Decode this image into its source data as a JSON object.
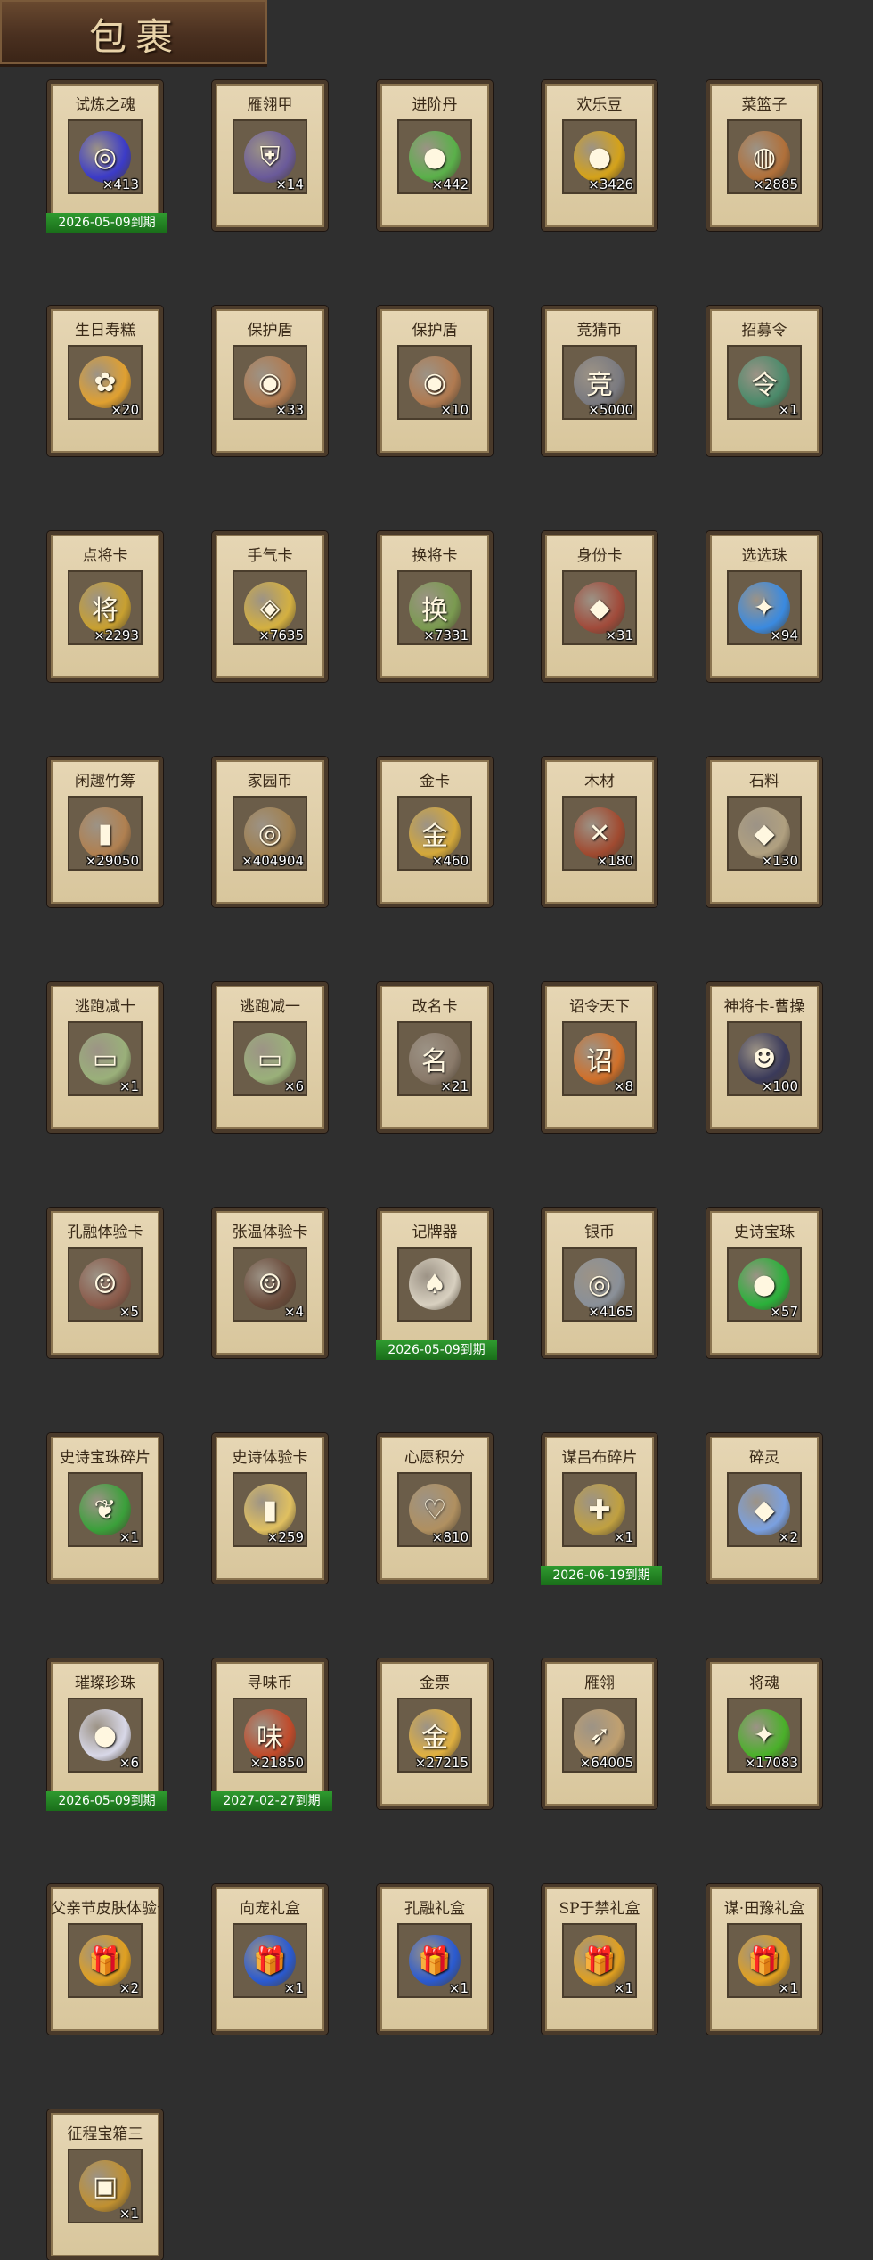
{
  "header": {
    "title": "包裹"
  },
  "items": [
    {
      "name": "试炼之魂",
      "count": "×413",
      "expiry": "2026-05-09到期",
      "icon": "blue-orb-icon",
      "color": "#3b3bc8",
      "glyph": "◎"
    },
    {
      "name": "雁翎甲",
      "count": "×14",
      "expiry": "",
      "icon": "armor-icon",
      "color": "#6a5a9a",
      "glyph": "⛨"
    },
    {
      "name": "进阶丹",
      "count": "×442",
      "expiry": "",
      "icon": "green-pill-icon",
      "color": "#5ab04a",
      "glyph": "●"
    },
    {
      "name": "欢乐豆",
      "count": "×3426",
      "expiry": "",
      "icon": "gold-beans-icon",
      "color": "#d4a21a",
      "glyph": "●"
    },
    {
      "name": "菜篮子",
      "count": "×2885",
      "expiry": "",
      "icon": "vegetable-basket-icon",
      "color": "#b0703a",
      "glyph": "◍"
    },
    {
      "name": "生日寿糕",
      "count": "×20",
      "expiry": "",
      "icon": "birthday-cake-icon",
      "color": "#e0a030",
      "glyph": "✿"
    },
    {
      "name": "保护盾",
      "count": "×33",
      "expiry": "",
      "icon": "shield-icon",
      "color": "#b07a50",
      "glyph": "◉"
    },
    {
      "name": "保护盾",
      "count": "×10",
      "expiry": "",
      "icon": "shield-icon",
      "color": "#b07a50",
      "glyph": "◉"
    },
    {
      "name": "竞猜币",
      "count": "×5000",
      "expiry": "",
      "icon": "guess-coin-icon",
      "color": "#7a7a80",
      "glyph": "竞"
    },
    {
      "name": "招募令",
      "count": "×1",
      "expiry": "",
      "icon": "recruit-token-icon",
      "color": "#4a8a6a",
      "glyph": "令"
    },
    {
      "name": "点将卡",
      "count": "×2293",
      "expiry": "",
      "icon": "general-card-icon",
      "color": "#c8a030",
      "glyph": "将"
    },
    {
      "name": "手气卡",
      "count": "×7635",
      "expiry": "",
      "icon": "luck-card-icon",
      "color": "#d4b040",
      "glyph": "◈"
    },
    {
      "name": "换将卡",
      "count": "×7331",
      "expiry": "",
      "icon": "swap-card-icon",
      "color": "#7a9a50",
      "glyph": "换"
    },
    {
      "name": "身份卡",
      "count": "×31",
      "expiry": "",
      "icon": "identity-card-icon",
      "color": "#a04a3a",
      "glyph": "◆"
    },
    {
      "name": "选选珠",
      "count": "×94",
      "expiry": "",
      "icon": "blue-flame-orb-icon",
      "color": "#3a8ae0",
      "glyph": "✦"
    },
    {
      "name": "闲趣竹筹",
      "count": "×29050",
      "expiry": "",
      "icon": "bamboo-token-icon",
      "color": "#b08050",
      "glyph": "▮"
    },
    {
      "name": "家园币",
      "count": "×404904",
      "expiry": "",
      "icon": "home-coin-icon",
      "color": "#a08050",
      "glyph": "◎"
    },
    {
      "name": "金卡",
      "count": "×460",
      "expiry": "",
      "icon": "gold-card-icon",
      "color": "#d4a83a",
      "glyph": "金"
    },
    {
      "name": "木材",
      "count": "×180",
      "expiry": "",
      "icon": "wood-icon",
      "color": "#a04a30",
      "glyph": "✕"
    },
    {
      "name": "石料",
      "count": "×130",
      "expiry": "",
      "icon": "stone-icon",
      "color": "#b0a080",
      "glyph": "◆"
    },
    {
      "name": "逃跑减十",
      "count": "×1",
      "expiry": "",
      "icon": "escape-tag-icon",
      "color": "#9ab07a",
      "glyph": "▭"
    },
    {
      "name": "逃跑减一",
      "count": "×6",
      "expiry": "",
      "icon": "escape-tag-icon",
      "color": "#9ab07a",
      "glyph": "▭"
    },
    {
      "name": "改名卡",
      "count": "×21",
      "expiry": "",
      "icon": "rename-card-icon",
      "color": "#8a7a6a",
      "glyph": "名"
    },
    {
      "name": "诏令天下",
      "count": "×8",
      "expiry": "",
      "icon": "edict-scroll-icon",
      "color": "#d0702a",
      "glyph": "诏"
    },
    {
      "name": "神将卡-曹操",
      "count": "×100",
      "expiry": "",
      "icon": "general-portrait-icon",
      "color": "#3a3a5a",
      "glyph": "☻"
    },
    {
      "name": "孔融体验卡",
      "count": "×5",
      "expiry": "",
      "icon": "general-portrait-icon",
      "color": "#8a5a4a",
      "glyph": "☺"
    },
    {
      "name": "张温体验卡",
      "count": "×4",
      "expiry": "",
      "icon": "general-portrait-icon",
      "color": "#6a4a3a",
      "glyph": "☺"
    },
    {
      "name": "记牌器",
      "count": "",
      "expiry": "2026-05-09到期",
      "icon": "playing-cards-icon",
      "color": "#d8d0c0",
      "glyph": "♠"
    },
    {
      "name": "银币",
      "count": "×4165",
      "expiry": "",
      "icon": "silver-coin-icon",
      "color": "#8a9098",
      "glyph": "◎"
    },
    {
      "name": "史诗宝珠",
      "count": "×57",
      "expiry": "",
      "icon": "green-orb-icon",
      "color": "#2ab03a",
      "glyph": "●"
    },
    {
      "name": "史诗宝珠碎片",
      "count": "×1",
      "expiry": "",
      "icon": "green-leaf-icon",
      "color": "#3aa03a",
      "glyph": "❦"
    },
    {
      "name": "史诗体验卡",
      "count": "×259",
      "expiry": "",
      "icon": "gold-card-icon",
      "color": "#e0c060",
      "glyph": "▮"
    },
    {
      "name": "心愿积分",
      "count": "×810",
      "expiry": "",
      "icon": "heart-coin-icon",
      "color": "#b09060",
      "glyph": "♡"
    },
    {
      "name": "谋吕布碎片",
      "count": "×1",
      "expiry": "2026-06-19到期",
      "icon": "puzzle-piece-icon",
      "color": "#c0a040",
      "glyph": "✚"
    },
    {
      "name": "碎灵",
      "count": "×2",
      "expiry": "",
      "icon": "crystal-icon",
      "color": "#7aa0e0",
      "glyph": "◆"
    },
    {
      "name": "璀璨珍珠",
      "count": "×6",
      "expiry": "2026-05-09到期",
      "icon": "pearl-icon",
      "color": "#d8d8e8",
      "glyph": "●"
    },
    {
      "name": "寻味币",
      "count": "×21850",
      "expiry": "2027-02-27到期",
      "icon": "taste-coin-icon",
      "color": "#c04a2a",
      "glyph": "味"
    },
    {
      "name": "金票",
      "count": "×27215",
      "expiry": "",
      "icon": "gold-ticket-icon",
      "color": "#e0b040",
      "glyph": "金"
    },
    {
      "name": "雁翎",
      "count": "×64005",
      "expiry": "",
      "icon": "feather-icon",
      "color": "#c0a070",
      "glyph": "➶"
    },
    {
      "name": "将魂",
      "count": "×17083",
      "expiry": "",
      "icon": "green-soul-icon",
      "color": "#4ab02a",
      "glyph": "✦"
    },
    {
      "name": "父亲节皮肤体验卡",
      "count": "×2",
      "expiry": "",
      "icon": "gift-box-icon",
      "color": "#e0a020",
      "glyph": "🎁"
    },
    {
      "name": "向宠礼盒",
      "count": "×1",
      "expiry": "",
      "icon": "gift-box-icon",
      "color": "#2a5ad0",
      "glyph": "🎁"
    },
    {
      "name": "孔融礼盒",
      "count": "×1",
      "expiry": "",
      "icon": "gift-box-icon",
      "color": "#2a5ad0",
      "glyph": "🎁"
    },
    {
      "name": "SP于禁礼盒",
      "count": "×1",
      "expiry": "",
      "icon": "gift-box-icon",
      "color": "#e0a020",
      "glyph": "🎁"
    },
    {
      "name": "谋·田豫礼盒",
      "count": "×1",
      "expiry": "",
      "icon": "gift-box-icon",
      "color": "#e0a020",
      "glyph": "🎁"
    },
    {
      "name": "征程宝箱三",
      "count": "×1",
      "expiry": "",
      "icon": "treasure-chest-icon",
      "color": "#c09030",
      "glyph": "▣"
    }
  ]
}
